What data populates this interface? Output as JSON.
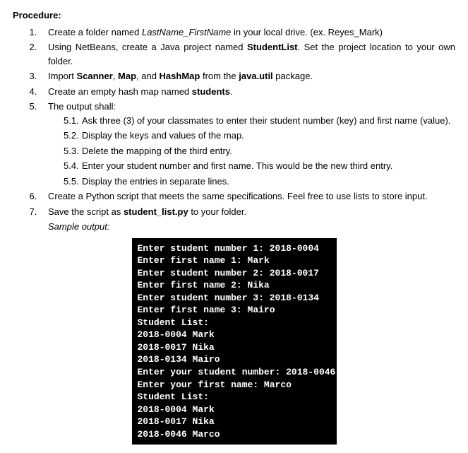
{
  "heading": "Procedure:",
  "items": {
    "n1": {
      "pre": "Create a folder named ",
      "italic": "LastName_FirstName",
      "post": " in your local drive. (ex. Reyes_Mark)"
    },
    "n2": {
      "pre": "Using NetBeans, create a Java project named ",
      "bold": "StudentList",
      "post": ". Set the project location to your own folder."
    },
    "n3": {
      "p1": "Import ",
      "b1": "Scanner",
      "p2": ", ",
      "b2": "Map",
      "p3": ", and ",
      "b3": "HashMap",
      "p4": " from the ",
      "b4": "java.util",
      "p5": " package."
    },
    "n4": {
      "pre": "Create an empty hash map named ",
      "bold": "students",
      "post": "."
    },
    "n5": {
      "text": "The output shall:",
      "sub": [
        {
          "num": "5.1.",
          "text": "Ask three (3) of your classmates to enter their student number (key) and first name (value)."
        },
        {
          "num": "5.2.",
          "text": "Display the keys and values of the map."
        },
        {
          "num": "5.3.",
          "text": "Delete the mapping of the third entry."
        },
        {
          "num": "5.4.",
          "text": "Enter your student number and first name. This would be the new third entry."
        },
        {
          "num": "5.5.",
          "text": "Display the entries in separate lines."
        }
      ]
    },
    "n6": "Create a Python script that meets the same specifications. Feel free to use lists to store input.",
    "n7": {
      "pre": "Save the script as ",
      "bold": "student_list.py",
      "post": " to your folder."
    }
  },
  "sample_label": "Sample output:",
  "terminal": "Enter student number 1: 2018-0004\nEnter first name 1: Mark\nEnter student number 2: 2018-0017\nEnter first name 2: Nika\nEnter student number 3: 2018-0134\nEnter first name 3: Mairo\nStudent List:\n2018-0004 Mark\n2018-0017 Nika\n2018-0134 Mairo\nEnter your student number: 2018-0046\nEnter your first name: Marco\nStudent List:\n2018-0004 Mark\n2018-0017 Nika\n2018-0046 Marco"
}
